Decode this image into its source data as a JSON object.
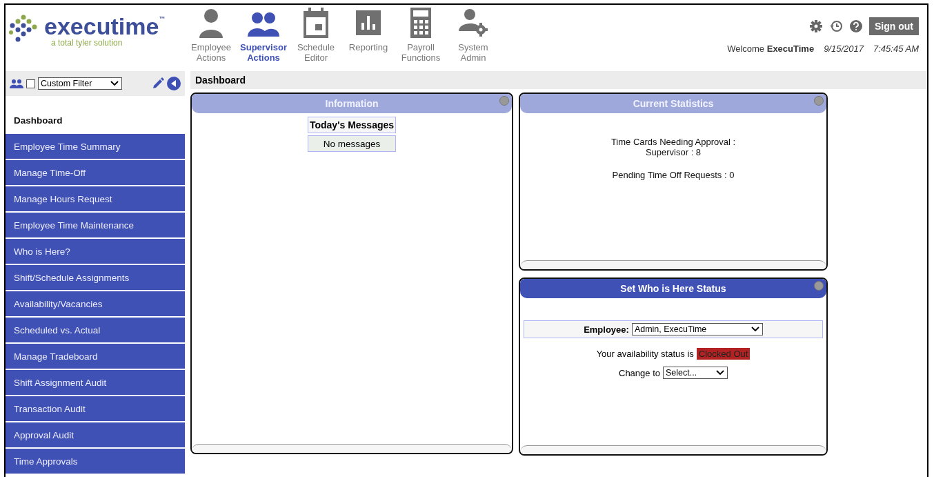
{
  "logo": {
    "name": "executime",
    "tm": "™",
    "tagline": "a total tyler solution"
  },
  "nav": [
    {
      "label": "Employee Actions",
      "selected": false
    },
    {
      "label": "Supervisor Actions",
      "selected": true
    },
    {
      "label": "Schedule Editor",
      "selected": false
    },
    {
      "label": "Reporting",
      "selected": false
    },
    {
      "label": "Payroll Functions",
      "selected": false
    },
    {
      "label": "System Admin",
      "selected": false
    }
  ],
  "user": {
    "sign_out": "Sign out",
    "welcome": "Welcome",
    "name": "ExecuTime",
    "date": "9/15/2017",
    "time": "7:45:45 AM"
  },
  "filter": {
    "checked": false,
    "value": "Custom Filter"
  },
  "breadcrumb": "Dashboard",
  "sidebar": {
    "items": [
      {
        "label": "Dashboard",
        "selected": true
      },
      {
        "label": "Employee Time Summary",
        "selected": false
      },
      {
        "label": "Manage Time-Off",
        "selected": false
      },
      {
        "label": "Manage Hours Request",
        "selected": false
      },
      {
        "label": "Employee Time Maintenance",
        "selected": false
      },
      {
        "label": "Who is Here?",
        "selected": false
      },
      {
        "label": "Shift/Schedule Assignments",
        "selected": false
      },
      {
        "label": "Availability/Vacancies",
        "selected": false
      },
      {
        "label": "Scheduled vs. Actual",
        "selected": false
      },
      {
        "label": "Manage Tradeboard",
        "selected": false
      },
      {
        "label": "Shift Assignment Audit",
        "selected": false
      },
      {
        "label": "Transaction Audit",
        "selected": false
      },
      {
        "label": "Approval Audit",
        "selected": false
      },
      {
        "label": "Time Approvals",
        "selected": false
      }
    ]
  },
  "panels": {
    "information": {
      "title": "Information",
      "focused": false,
      "messages_heading": "Today's Messages",
      "messages": [
        "No messages"
      ]
    },
    "statistics": {
      "title": "Current Statistics",
      "focused": false,
      "lines": [
        [
          "Time Cards Needing Approval :",
          "Supervisor : 8"
        ],
        [
          "Pending Time Off Requests : 0"
        ]
      ]
    },
    "who_is_here": {
      "title": "Set Who is Here Status",
      "focused": true,
      "employee_label": "Employee:",
      "employee": "Admin, ExecuTime",
      "status_label": "Your availability status is",
      "status": "Clocked Out",
      "change_label": "Change to",
      "change_value": "Select..."
    }
  }
}
